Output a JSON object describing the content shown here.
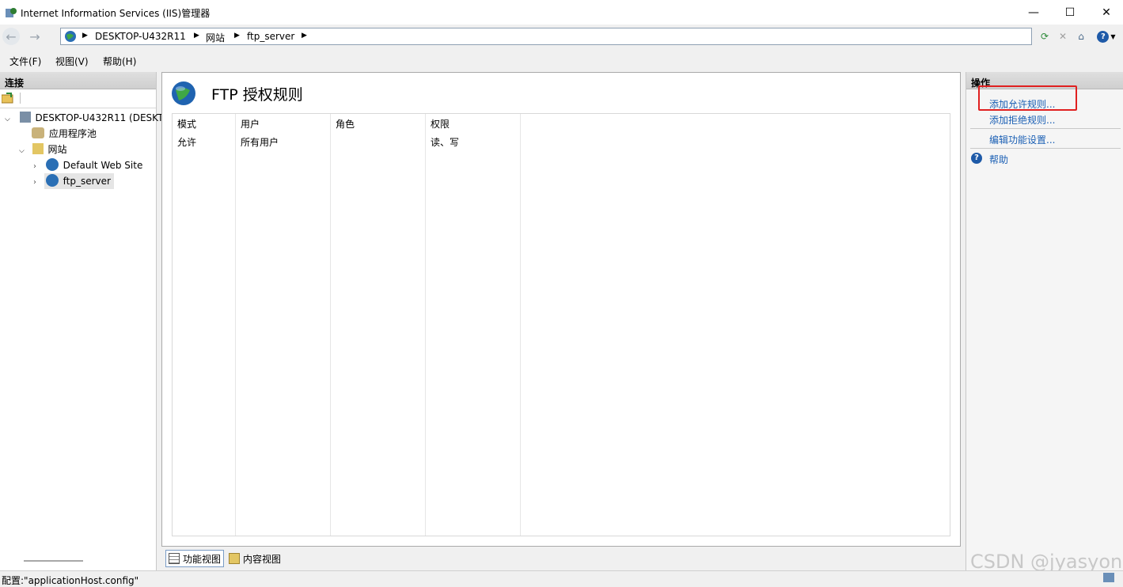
{
  "window": {
    "title": "Internet Information Services (IIS)管理器",
    "controls": {
      "minimize": "—",
      "maximize": "☐",
      "close": "✕"
    }
  },
  "address": {
    "breadcrumbs": [
      "DESKTOP-U432R11",
      "网站",
      "ftp_server"
    ]
  },
  "menu": [
    "文件(F)",
    "视图(V)",
    "帮助(H)"
  ],
  "connections": {
    "header": "连接",
    "tree": {
      "server": "DESKTOP-U432R11 (DESKT",
      "app_pools": "应用程序池",
      "sites": "网站",
      "default_site": "Default Web Site",
      "ftp_site": "ftp_server"
    }
  },
  "feature": {
    "title": "FTP 授权规则",
    "columns": [
      "模式",
      "用户",
      "角色",
      "权限"
    ],
    "rows": [
      [
        "允许",
        "所有用户",
        "",
        "读、写"
      ]
    ]
  },
  "views": {
    "feature_view": "功能视图",
    "content_view": "内容视图"
  },
  "actions": {
    "header": "操作",
    "add_allow": "添加允许规则...",
    "add_deny": "添加拒绝规则...",
    "edit_settings": "编辑功能设置...",
    "help": "帮助"
  },
  "status": {
    "text": "配置:\"applicationHost.config\""
  },
  "watermark": "CSDN @jyasyon",
  "colors": {
    "link": "#1a5fb4",
    "highlight_box": "#e02020"
  }
}
